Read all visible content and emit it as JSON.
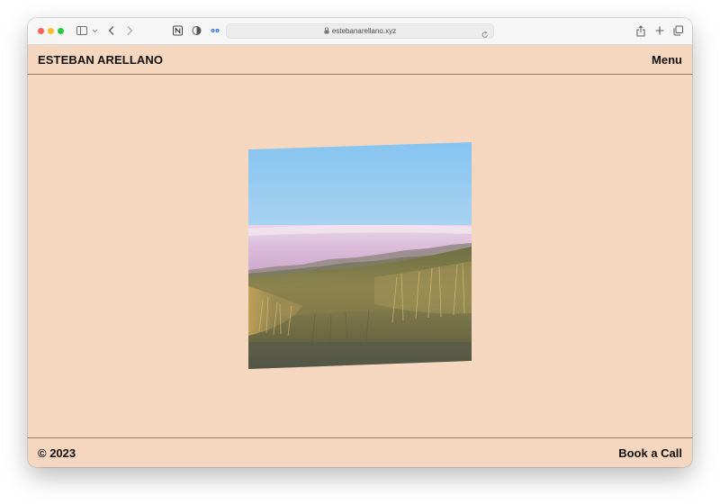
{
  "browser": {
    "url": "estebanarellano.xyz"
  },
  "header": {
    "brand": "ESTEBAN ARELLANO",
    "menu_label": "Menu"
  },
  "hero": {
    "image_subject": "landscape-photo"
  },
  "footer": {
    "copyright": "© 2023",
    "cta_label": "Book a Call"
  },
  "colors": {
    "page_background": "#f5d7bf",
    "divider": "#8f7b6c",
    "text": "#111111"
  }
}
